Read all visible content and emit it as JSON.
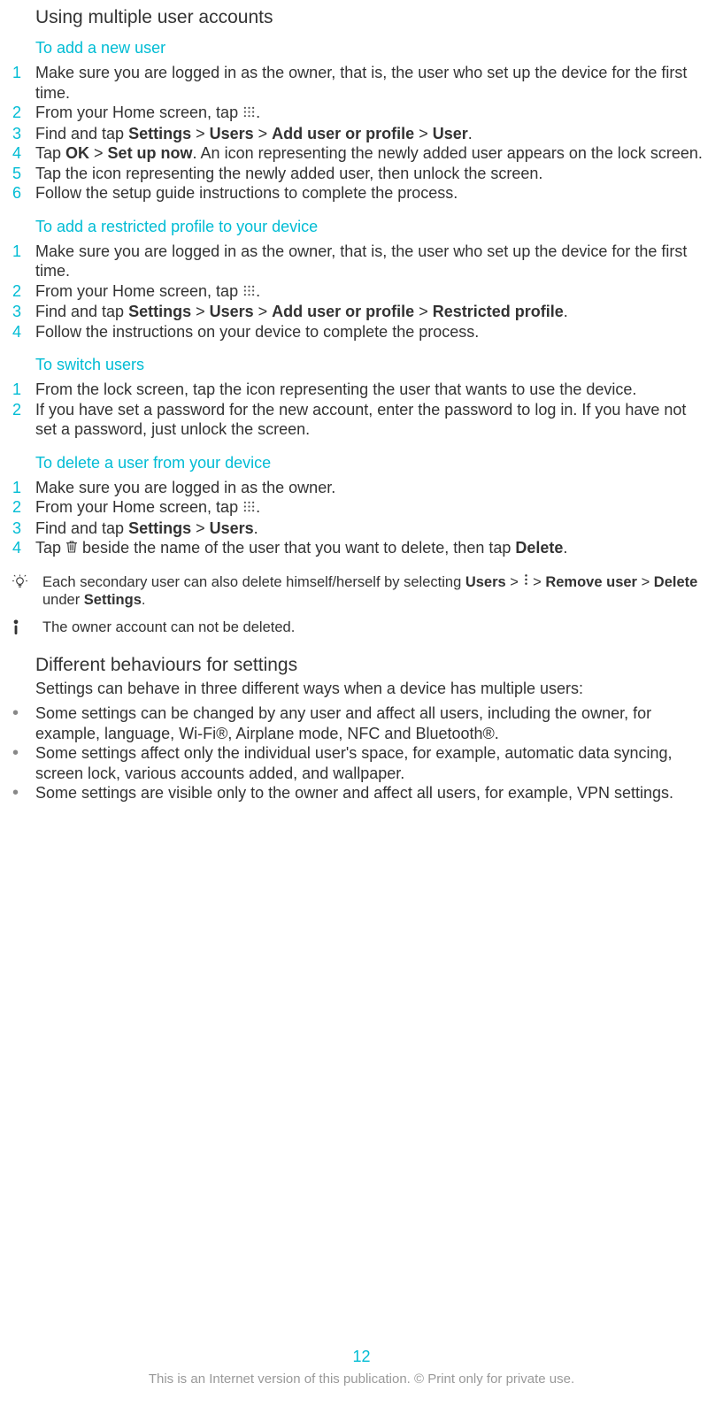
{
  "main_heading": "Using multiple user accounts",
  "section_add_user": {
    "heading": "To add a new user",
    "steps": [
      {
        "n": "1",
        "pre": "Make sure you are logged in as the owner, that is, the user who set up the device for the first time."
      },
      {
        "n": "2",
        "pre": "From your Home screen, tap ",
        "icon": "apps",
        "post": "."
      },
      {
        "n": "3",
        "pre": "Find and tap ",
        "b1": "Settings",
        "s1": " > ",
        "b2": "Users",
        "s2": " > ",
        "b3": "Add user or profile",
        "s3": " > ",
        "b4": "User",
        "post": "."
      },
      {
        "n": "4",
        "pre": "Tap ",
        "b1": "OK",
        "s1": " > ",
        "b2": "Set up now",
        "post": ". An icon representing the newly added user appears on the lock screen."
      },
      {
        "n": "5",
        "pre": "Tap the icon representing the newly added user, then unlock the screen."
      },
      {
        "n": "6",
        "pre": "Follow the setup guide instructions to complete the process."
      }
    ]
  },
  "section_restricted": {
    "heading": "To add a restricted profile to your device",
    "steps": [
      {
        "n": "1",
        "pre": "Make sure you are logged in as the owner, that is, the user who set up the device for the first time."
      },
      {
        "n": "2",
        "pre": "From your Home screen, tap ",
        "icon": "apps",
        "post": "."
      },
      {
        "n": "3",
        "pre": "Find and tap ",
        "b1": "Settings",
        "s1": " > ",
        "b2": "Users",
        "s2": " > ",
        "b3": "Add user or profile",
        "s3": " > ",
        "b4": "Restricted profile",
        "post": "."
      },
      {
        "n": "4",
        "pre": "Follow the instructions on your device to complete the process."
      }
    ]
  },
  "section_switch": {
    "heading": "To switch users",
    "steps": [
      {
        "n": "1",
        "pre": "From the lock screen, tap the icon representing the user that wants to use the device."
      },
      {
        "n": "2",
        "pre": "If you have set a password for the new account, enter the password to log in. If you have not set a password, just unlock the screen."
      }
    ]
  },
  "section_delete": {
    "heading": "To delete a user from your device",
    "steps": [
      {
        "n": "1",
        "pre": "Make sure you are logged in as the owner."
      },
      {
        "n": "2",
        "pre": "From your Home screen, tap ",
        "icon": "apps",
        "post": "."
      },
      {
        "n": "3",
        "pre": "Find and tap ",
        "b1": "Settings",
        "s1": " > ",
        "b2": "Users",
        "post": "."
      },
      {
        "n": "4",
        "pre": "Tap ",
        "icon": "trash",
        "mid": " beside the name of the user that you want to delete, then tap ",
        "b1": "Delete",
        "post": "."
      }
    ]
  },
  "tip_note": {
    "pre": "Each secondary user can also delete himself/herself by selecting ",
    "b1": "Users",
    "s1": " > ",
    "icon": "overflow",
    "s2": " > ",
    "b2": "Remove user",
    "s3": " > ",
    "b3": "Delete",
    "mid": " under ",
    "b4": "Settings",
    "post": "."
  },
  "warn_note": "The owner account can not be deleted.",
  "section_behaviours": {
    "heading": "Different behaviours for settings",
    "intro": "Settings can behave in three different ways when a device has multiple users:",
    "bullets": [
      "Some settings can be changed by any user and affect all users, including the owner, for example, language, Wi-Fi®, Airplane mode, NFC and Bluetooth®.",
      "Some settings affect only the individual user's space, for example, automatic data syncing, screen lock, various accounts added, and wallpaper.",
      "Some settings are visible only to the owner and affect all users, for example, VPN settings."
    ]
  },
  "page_number": "12",
  "footer_text": "This is an Internet version of this publication. © Print only for private use."
}
